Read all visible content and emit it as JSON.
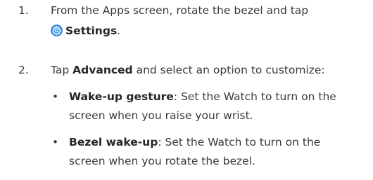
{
  "steps": [
    {
      "number": "1.",
      "line1": "From the Apps screen, rotate the bezel and tap",
      "icon": "settings-gear-icon",
      "bold_label": "Settings",
      "suffix": "."
    },
    {
      "number": "2.",
      "prefix": "Tap ",
      "bold_label": "Advanced",
      "suffix": " and select an option to customize:"
    }
  ],
  "bullets": [
    {
      "dot": "•",
      "bold_label": "Wake-up gesture",
      "line1_rest": ": Set the Watch to turn on the",
      "line2": "screen when you raise your wrist."
    },
    {
      "dot": "•",
      "bold_label": "Bezel wake-up",
      "line1_rest": ": Set the Watch to turn on the",
      "line2": "screen when you rotate the bezel."
    }
  ],
  "colors": {
    "text": "#3b3b3b",
    "icon_bg": "#3a8ee6",
    "icon_fg": "#ffffff"
  }
}
